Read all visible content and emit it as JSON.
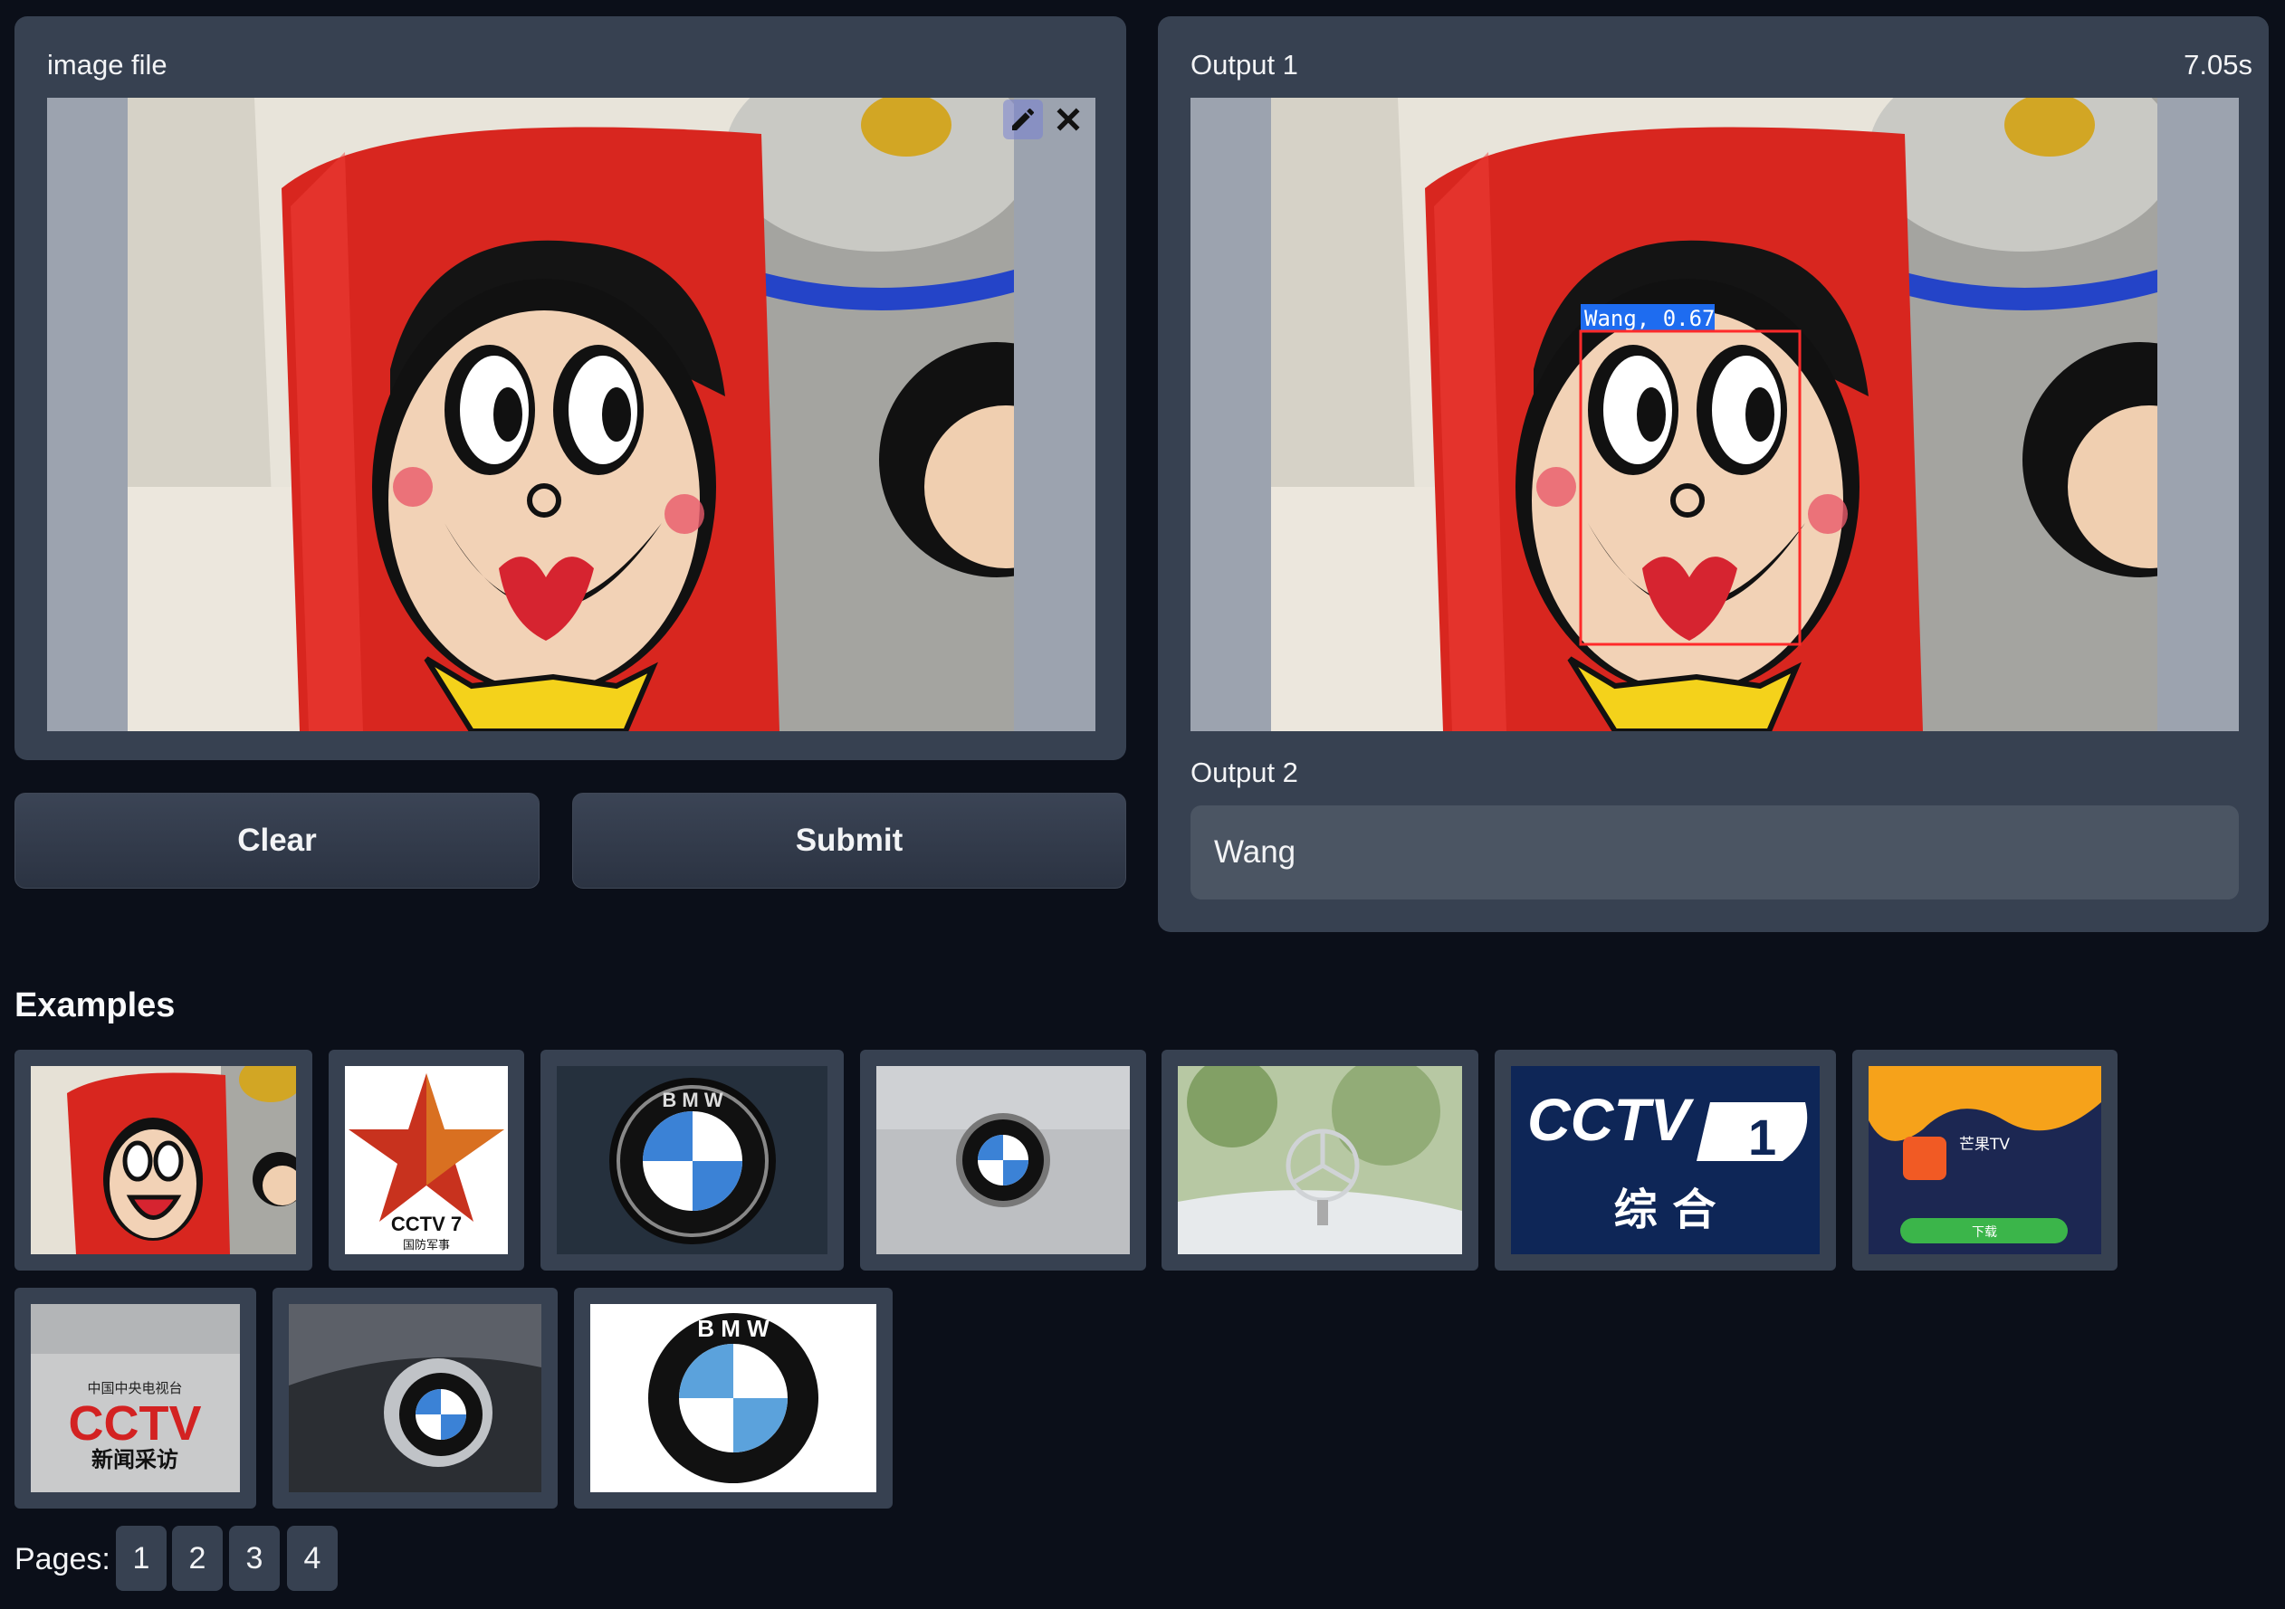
{
  "input": {
    "label": "image file"
  },
  "output1": {
    "label": "Output 1",
    "time": "7.05s",
    "detection_label": "Wang, 0.67"
  },
  "output2": {
    "label": "Output 2",
    "value": "Wang"
  },
  "buttons": {
    "clear": "Clear",
    "submit": "Submit"
  },
  "examples": {
    "title": "Examples",
    "cctv7_text": "CCTV 7",
    "cctv7_sub": "国防军事",
    "cctv1_text": "CCTV",
    "cctv1_num": "1",
    "cctv1_sub": "综  合",
    "mango_name": "芒果TV",
    "mango_download": "下载",
    "cctvnews_top": "中国中央电视台",
    "cctvnews_text": "CCTV",
    "cctvnews_sub": "新闻采访",
    "bmw_letters": "B M W"
  },
  "pagination": {
    "label": "Pages:",
    "pages": [
      "1",
      "2",
      "3",
      "4"
    ]
  },
  "colors": {
    "background": "#0b0f19",
    "panel": "#374151",
    "accent_box": "#ff2a2a",
    "label_bg": "#1e6cf0"
  }
}
